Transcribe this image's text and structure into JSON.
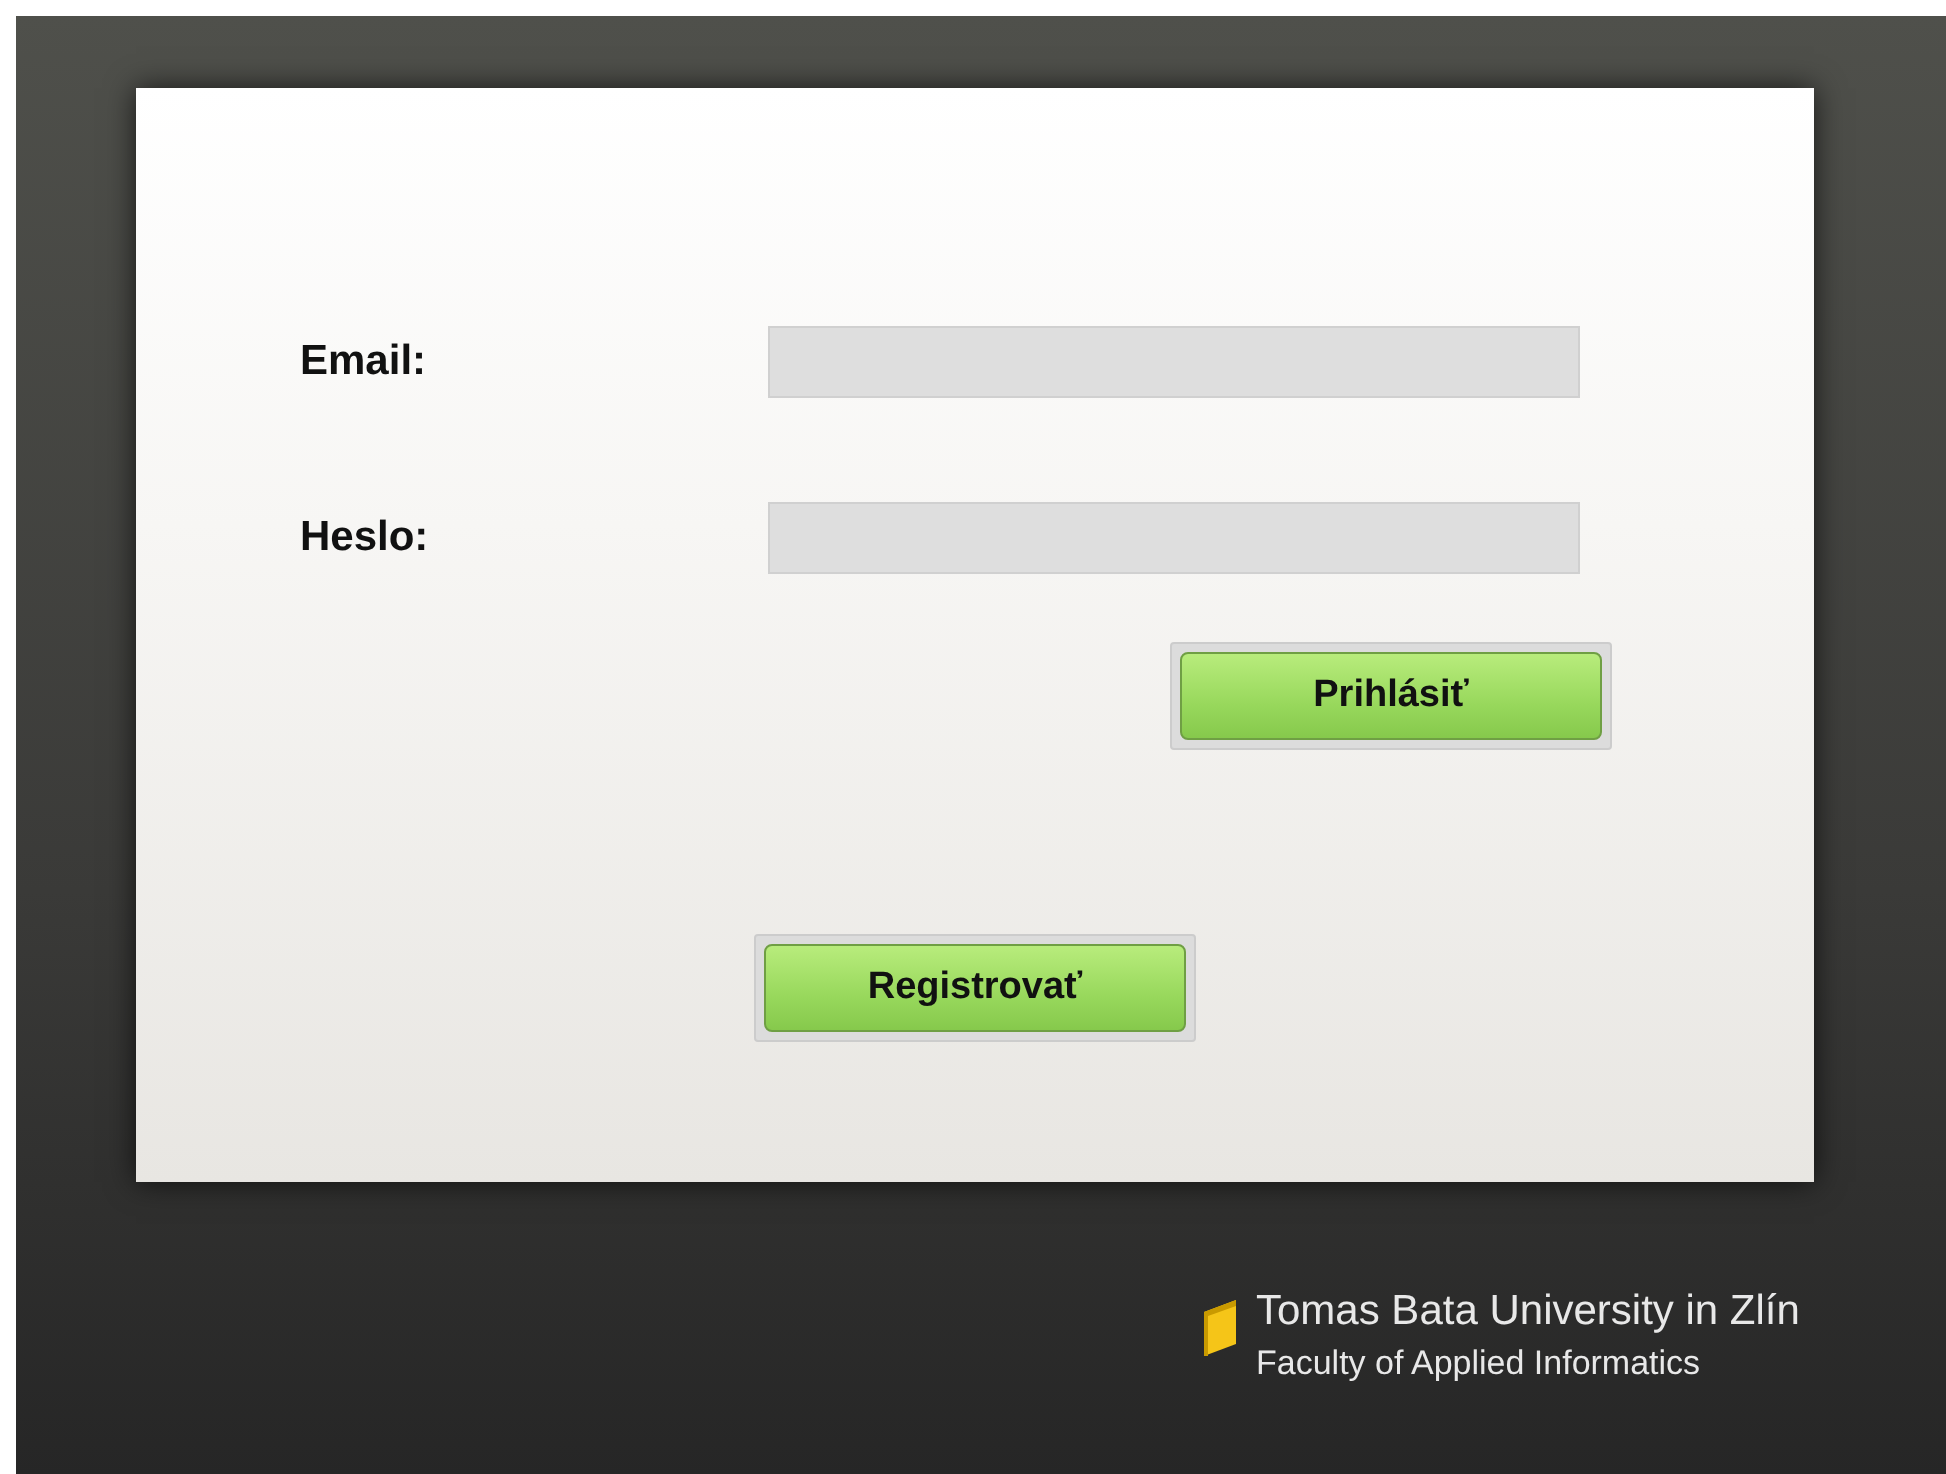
{
  "form": {
    "fields": [
      {
        "label": "Email:"
      },
      {
        "label": "Heslo:"
      }
    ],
    "login_button": "Prihlásiť",
    "register_button": "Registrovať"
  },
  "footer": {
    "university": "Tomas Bata University in Zlín",
    "faculty": "Faculty of Applied Informatics"
  }
}
